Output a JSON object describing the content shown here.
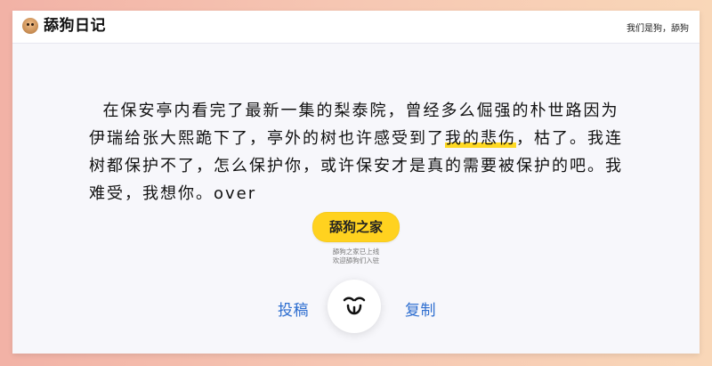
{
  "header": {
    "brand_title": "舔狗日记",
    "right_text": "我们是狗，舔狗"
  },
  "content": {
    "text_before": "在保安亭内看完了最新一集的梨泰院，曾经多么倔强的朴世路因为伊瑞给张大熙跪下了，亭外的树也许感受到了",
    "text_highlight": "我的悲伤",
    "text_after": "，枯了。我连树都保护不了，怎么保护你，或许保安才是真的需要被保护的吧。我难受，我想你。over"
  },
  "pill": {
    "label": "舔狗之家",
    "sub_line1": "舔狗之家已上线",
    "sub_line2": "欢迎舔狗们入驻"
  },
  "actions": {
    "left_label": "投稿",
    "right_label": "复制"
  },
  "colors": {
    "accent_yellow": "#ffd21f",
    "link_blue": "#2f6fd0"
  }
}
